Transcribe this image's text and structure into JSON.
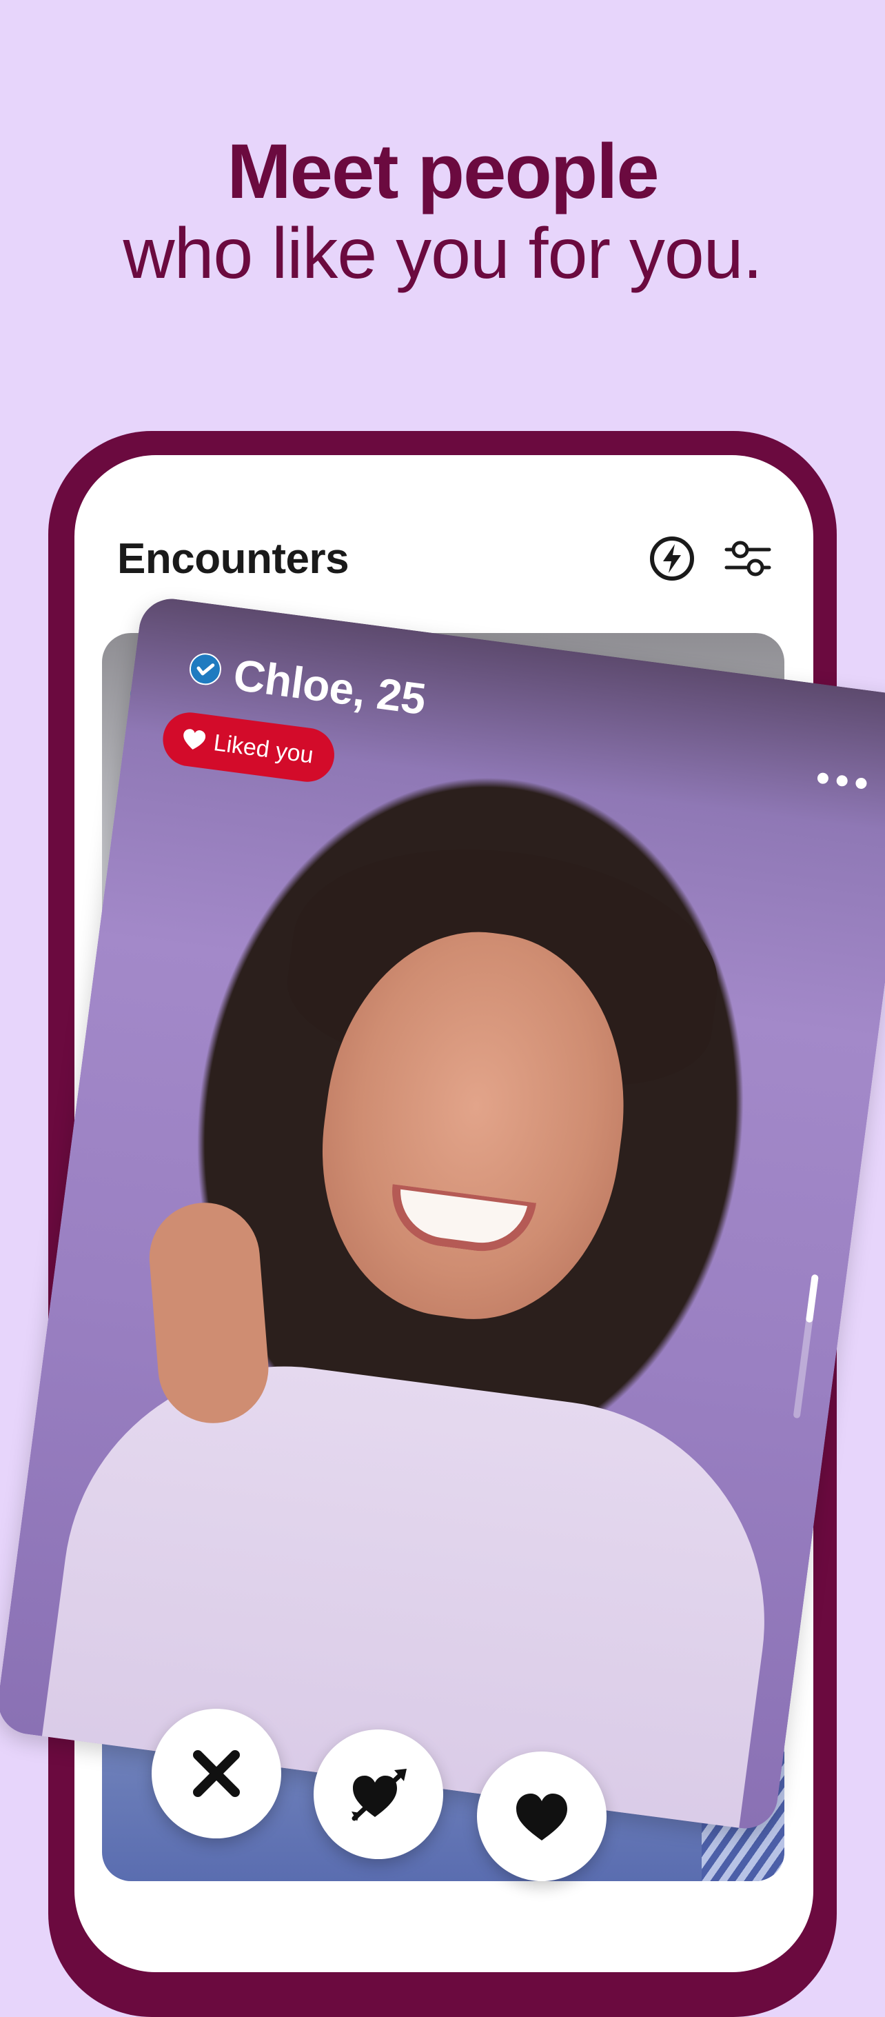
{
  "headline": {
    "line1": "Meet people",
    "line2": "who like you for you."
  },
  "app": {
    "title": "Encounters",
    "icons": {
      "boost": "lightning-circle-icon",
      "filters": "sliders-icon"
    }
  },
  "profile": {
    "name_age": "Chloe, 25",
    "verified": true,
    "badge": "Liked you",
    "more_icon": "more-dots-icon"
  },
  "actions": [
    {
      "name": "pass",
      "icon": "close-icon"
    },
    {
      "name": "crush",
      "icon": "heart-arrow-icon"
    },
    {
      "name": "like",
      "icon": "heart-icon"
    }
  ],
  "colors": {
    "background": "#e7d5fb",
    "brand": "#6b0a3f",
    "liked_badge": "#d30b2a",
    "verified_blue": "#1f7bc0"
  }
}
